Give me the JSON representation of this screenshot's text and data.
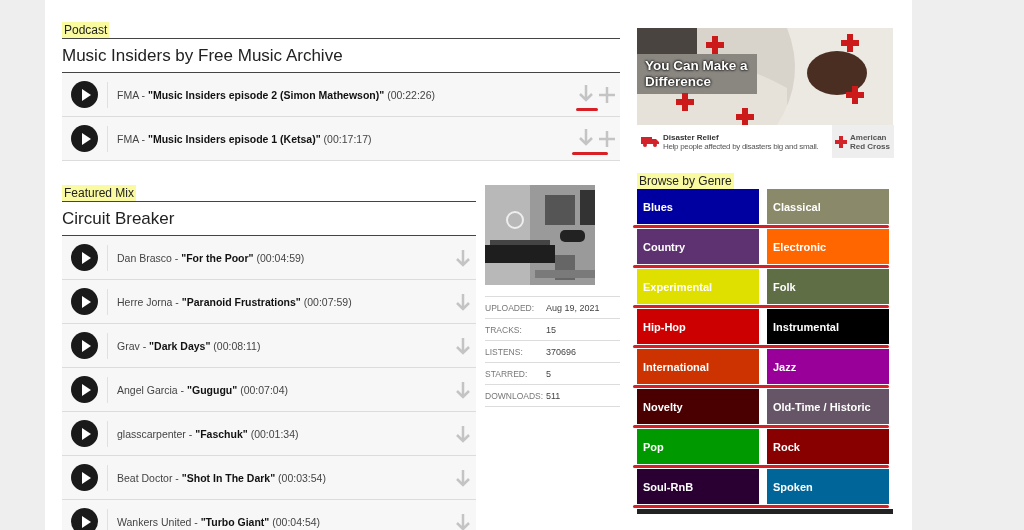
{
  "podcast": {
    "label": "Podcast",
    "title": "Music Insiders by Free Music Archive",
    "tracks": [
      {
        "text": "FMA - **\"Music Insiders episode 2 (Simon Mathewson)\"** (00:22:26)"
      },
      {
        "text": "FMA - **\"Music Insiders episode 1 (Ketsa)\"** (00:17:17)"
      }
    ]
  },
  "featured_mix": {
    "label": "Featured Mix",
    "title": "Circuit Breaker",
    "tracks": [
      {
        "text": "Dan Brasco - **\"For the Poor\"** (00:04:59)"
      },
      {
        "text": "Herre Jorna - **\"Paranoid Frustrations\"** (00:07:59)"
      },
      {
        "text": "Grav - **\"Dark Days\"** (00:08:11)"
      },
      {
        "text": "Angel Garcia - **\"Gugugu\"** (00:07:04)"
      },
      {
        "text": "glasscarpenter - **\"Faschuk\"** (00:01:34)"
      },
      {
        "text": "Beat Doctor - **\"Shot In The Dark\"** (00:03:54)"
      },
      {
        "text": "Wankers United - **\"Turbo Giant\"** (00:04:54)"
      }
    ],
    "stats": [
      {
        "label": "UPLOADED:",
        "value": "Aug 19, 2021"
      },
      {
        "label": "TRACKS:",
        "value": "15"
      },
      {
        "label": "LISTENS:",
        "value": "370696"
      },
      {
        "label": "STARRED:",
        "value": "5"
      },
      {
        "label": "DOWNLOADS:",
        "value": "511"
      }
    ]
  },
  "ad": {
    "headline": "You Can Make a Difference",
    "title": "Disaster Relief",
    "text": "Help people affected by disasters big and small.",
    "brand": "American Red Cross"
  },
  "genres": {
    "label": "Browse by Genre",
    "items": [
      {
        "name": "Blues",
        "color": "#0000a0"
      },
      {
        "name": "Classical",
        "color": "#8a8a6a"
      },
      {
        "name": "Country",
        "color": "#5e3270"
      },
      {
        "name": "Electronic",
        "color": "#ff6600"
      },
      {
        "name": "Experimental",
        "color": "#e0e000"
      },
      {
        "name": "Folk",
        "color": "#5f6e45"
      },
      {
        "name": "Hip-Hop",
        "color": "#cc0000"
      },
      {
        "name": "Instrumental",
        "color": "#000000"
      },
      {
        "name": "International",
        "color": "#cc3300"
      },
      {
        "name": "Jazz",
        "color": "#990099"
      },
      {
        "name": "Novelty",
        "color": "#4a0000"
      },
      {
        "name": "Old-Time / Historic",
        "color": "#665566"
      },
      {
        "name": "Pop",
        "color": "#009900"
      },
      {
        "name": "Rock",
        "color": "#880000"
      },
      {
        "name": "Soul-RnB",
        "color": "#2a0033"
      },
      {
        "name": "Spoken",
        "color": "#006699"
      }
    ]
  }
}
